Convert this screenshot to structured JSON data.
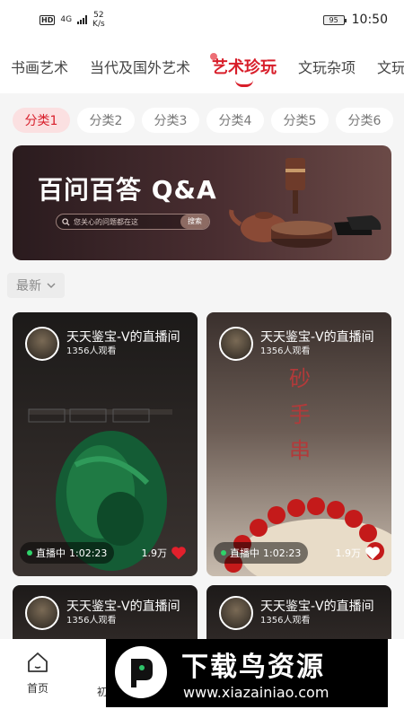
{
  "status_bar": {
    "network": "4G",
    "speed_value": "52",
    "speed_unit": "K/s",
    "battery": "95",
    "time": "10:50"
  },
  "top_tabs": [
    {
      "label": "书画艺术",
      "active": false
    },
    {
      "label": "当代及国外艺术",
      "active": false
    },
    {
      "label": "艺术珍玩",
      "active": true
    },
    {
      "label": "文玩杂项",
      "active": false
    },
    {
      "label": "文玩",
      "active": false
    }
  ],
  "sub_tabs": [
    {
      "label": "分类1",
      "active": true
    },
    {
      "label": "分类2",
      "active": false
    },
    {
      "label": "分类3",
      "active": false
    },
    {
      "label": "分类4",
      "active": false
    },
    {
      "label": "分类5",
      "active": false
    },
    {
      "label": "分类6",
      "active": false
    }
  ],
  "banner": {
    "title": "百问百答 Q&A",
    "search_placeholder": "您关心的问题都在这",
    "search_button": "搜索"
  },
  "sort": {
    "label": "最新"
  },
  "cards": [
    {
      "host": "天天鉴宝-V的直播间",
      "viewers": "1356人观看",
      "status": "直播中",
      "duration": "1:02:23",
      "likes": "1.9万",
      "liked": true
    },
    {
      "host": "天天鉴宝-V的直播间",
      "viewers": "1356人观看",
      "status": "直播中",
      "duration": "1:02:23",
      "likes": "1.9万",
      "liked": false
    },
    {
      "host": "天天鉴宝-V的直播间",
      "viewers": "1356人观看"
    },
    {
      "host": "天天鉴宝-V的直播间",
      "viewers": "1356人观看"
    }
  ],
  "bottom_nav": {
    "home_label": "首页",
    "second_label_partial": "初"
  },
  "watermark": {
    "title": "下载鸟资源",
    "url": "www.xiazainiao.com"
  },
  "colors": {
    "accent": "#d81e2a",
    "pill_active_bg": "#fbe0e1"
  }
}
